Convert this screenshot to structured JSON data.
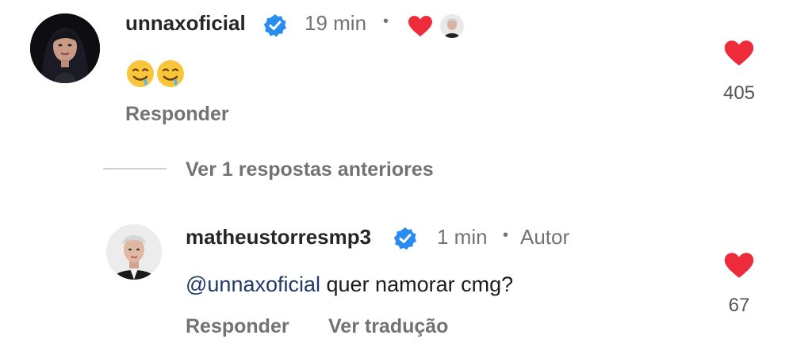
{
  "comment": {
    "username": "unnaxoficial",
    "time": "19 min",
    "separator": "•",
    "emoji_text": "🤤🤤",
    "reply_label": "Responder",
    "like_count": "405",
    "verified_icon": "verified-badge-icon",
    "liked_by_author_icon": "heart-icon"
  },
  "view_replies": {
    "label": "Ver 1 respostas anteriores"
  },
  "reply": {
    "username": "matheustorresmp3",
    "time": "1 min",
    "separator": "•",
    "author_badge": "Autor",
    "mention": "@unnaxoficial",
    "text": " quer namorar cmg?",
    "reply_label": "Responder",
    "translate_label": "Ver tradução",
    "like_count": "67"
  },
  "colors": {
    "heart": "#ed2b3b",
    "verified": "#2a8cf0",
    "muted": "#737373",
    "mention": "#1f3a68"
  }
}
